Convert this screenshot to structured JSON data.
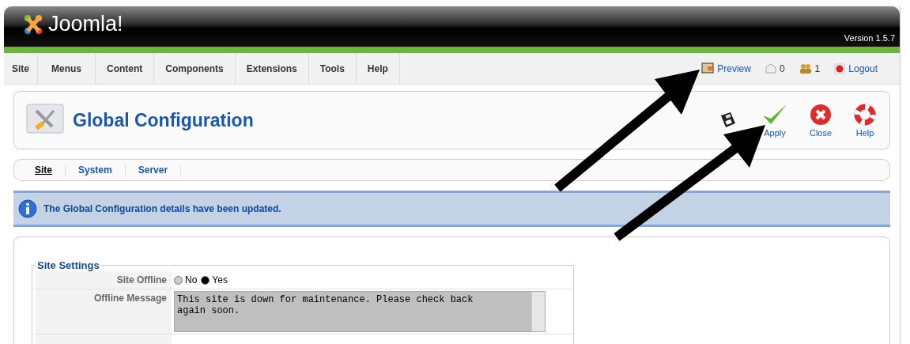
{
  "header": {
    "logo": "Joomla!",
    "version": "Version 1.5.7"
  },
  "menu": {
    "items": [
      "Site",
      "Menus",
      "Content",
      "Components",
      "Extensions",
      "Tools",
      "Help"
    ],
    "preview": "Preview",
    "messages": "0",
    "users": "1",
    "logout": "Logout"
  },
  "toolbar": {
    "title": "Global Configuration",
    "buttons": [
      {
        "kind": "save"
      },
      {
        "kind": "apply",
        "label": "Apply"
      },
      {
        "kind": "close",
        "label": "Close"
      },
      {
        "kind": "help",
        "label": "Help"
      }
    ]
  },
  "tabs": [
    {
      "label": "Site",
      "selected": true
    },
    {
      "label": "System",
      "selected": false
    },
    {
      "label": "Server",
      "selected": false
    }
  ],
  "message": "The Global Configuration details have been updated.",
  "settings": {
    "legend": "Site Settings",
    "site_offline": {
      "label": "Site Offline",
      "options": [
        {
          "label": "No",
          "selected": false
        },
        {
          "label": "Yes",
          "selected": true
        }
      ]
    },
    "offline_message": {
      "label": "Offline Message",
      "value": "This site is down for maintenance. Please check back again soon."
    }
  }
}
